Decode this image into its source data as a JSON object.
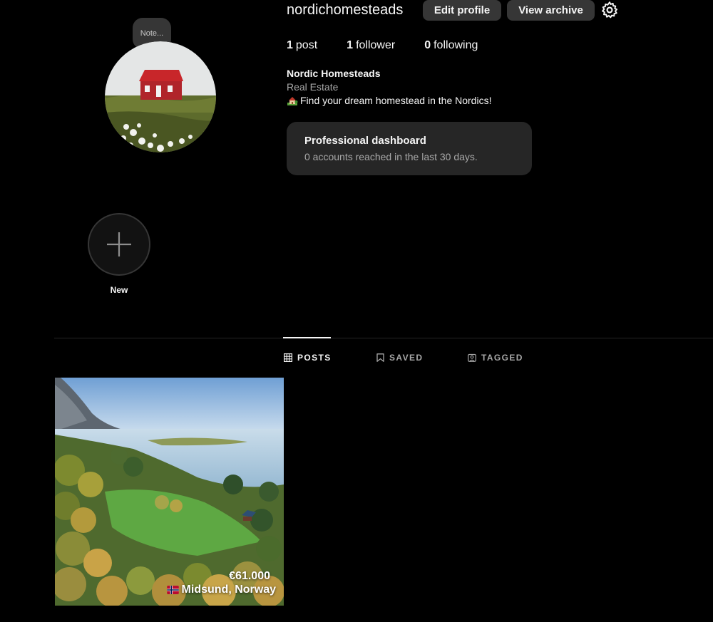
{
  "profile": {
    "username": "nordichomesteads",
    "full_name": "Nordic Homesteads",
    "category": "Real Estate",
    "bio": "Find your dream homestead in the Nordics!",
    "bio_icon": "house-with-garden-icon",
    "note_placeholder": "Note..."
  },
  "actions": {
    "edit_profile": "Edit profile",
    "view_archive": "View archive",
    "settings_icon": "gear-icon"
  },
  "stats": {
    "posts_count": "1",
    "posts_label": "post",
    "followers_count": "1",
    "followers_label": "follower",
    "following_count": "0",
    "following_label": "following"
  },
  "dashboard": {
    "title": "Professional dashboard",
    "subtitle": "0 accounts reached in the last 30 days."
  },
  "highlights": {
    "new_label": "New"
  },
  "tabs": [
    {
      "label": "POSTS",
      "icon": "grid-icon",
      "active": true
    },
    {
      "label": "SAVED",
      "icon": "bookmark-icon",
      "active": false
    },
    {
      "label": "TAGGED",
      "icon": "tagged-icon",
      "active": false
    }
  ],
  "posts": [
    {
      "price": "€61.000",
      "location": "Midsund, Norway",
      "flag": "norway-flag-icon"
    }
  ],
  "colors": {
    "background": "#000000",
    "button": "#363636",
    "card": "#262626",
    "secondary_text": "#a8a8a8"
  }
}
